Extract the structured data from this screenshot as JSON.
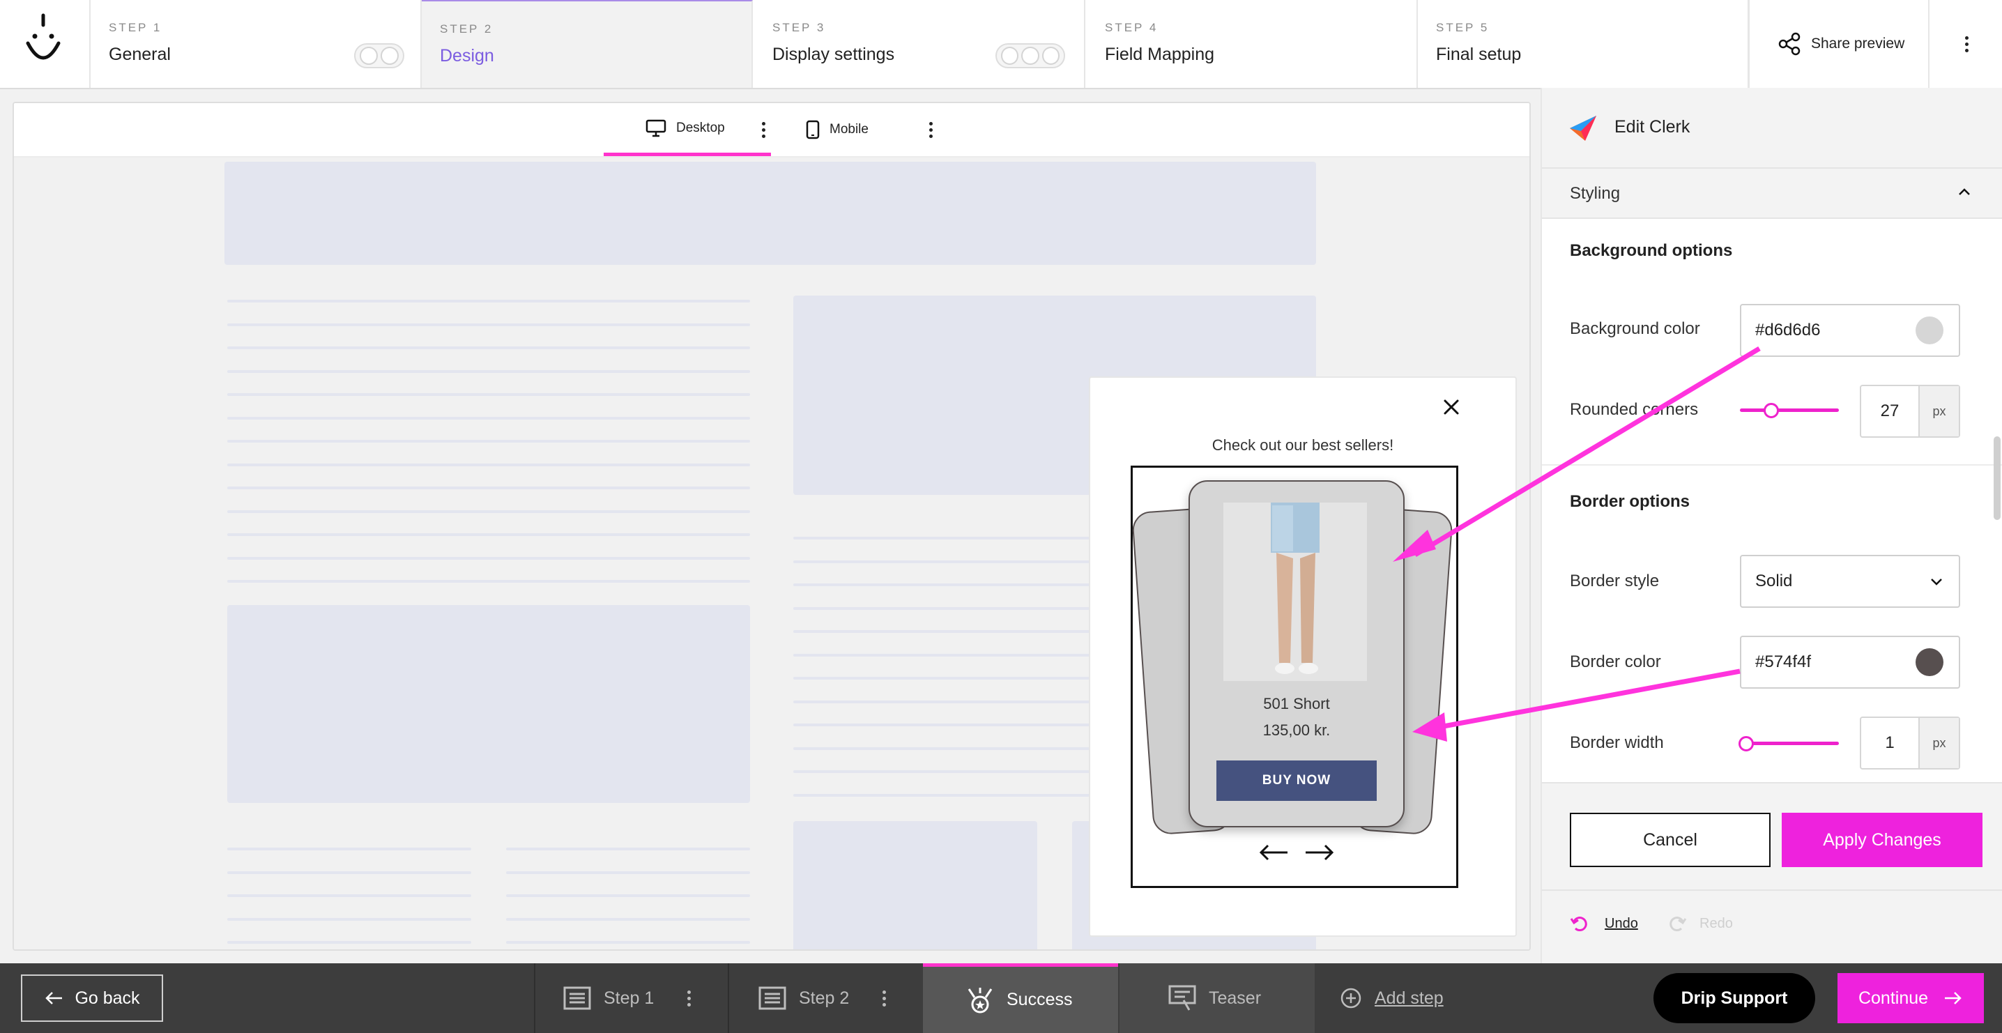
{
  "header": {
    "steps": [
      {
        "num": "STEP 1",
        "title": "General"
      },
      {
        "num": "STEP 2",
        "title": "Design"
      },
      {
        "num": "STEP 3",
        "title": "Display settings"
      },
      {
        "num": "STEP 4",
        "title": "Field Mapping"
      },
      {
        "num": "STEP 5",
        "title": "Final setup"
      }
    ],
    "share_label": "Share preview"
  },
  "device_tabs": {
    "desktop": "Desktop",
    "mobile": "Mobile"
  },
  "popup": {
    "heading": "Check out our best sellers!",
    "product_name": "501 Short",
    "product_price": "135,00 kr.",
    "buy_label": "BUY NOW"
  },
  "panel": {
    "title": "Edit Clerk",
    "section": "Styling",
    "background_heading": "Background options",
    "background_color_label": "Background color",
    "background_color_value": "#d6d6d6",
    "rounded_label": "Rounded corners",
    "rounded_value": "27",
    "rounded_unit": "px",
    "border_heading": "Border options",
    "border_style_label": "Border style",
    "border_style_value": "Solid",
    "border_color_label": "Border color",
    "border_color_value": "#574f4f",
    "border_width_label": "Border width",
    "border_width_value": "1",
    "border_width_unit": "px",
    "cancel_label": "Cancel",
    "apply_label": "Apply Changes",
    "undo_label": "Undo",
    "redo_label": "Redo"
  },
  "bottom": {
    "go_back": "Go back",
    "tabs": [
      "Step 1",
      "Step 2",
      "Success",
      "Teaser"
    ],
    "add_step": "Add step",
    "drip_support": "Drip Support",
    "continue": "Continue"
  },
  "colors": {
    "accent": "#ff33cc",
    "design_step": "#7b5ce0",
    "buy_button": "#45527f",
    "bottom_bar": "#3d3d3d"
  },
  "icons": [
    "logo-icon",
    "share-icon",
    "desktop-icon",
    "mobile-icon",
    "close-icon",
    "clerk-logo-icon",
    "chevron-up-icon",
    "chevron-down-icon",
    "undo-icon",
    "redo-icon",
    "arrow-left-icon",
    "arrow-right-icon",
    "page-icon",
    "badge-icon",
    "teaser-icon",
    "plus-circle-icon"
  ]
}
